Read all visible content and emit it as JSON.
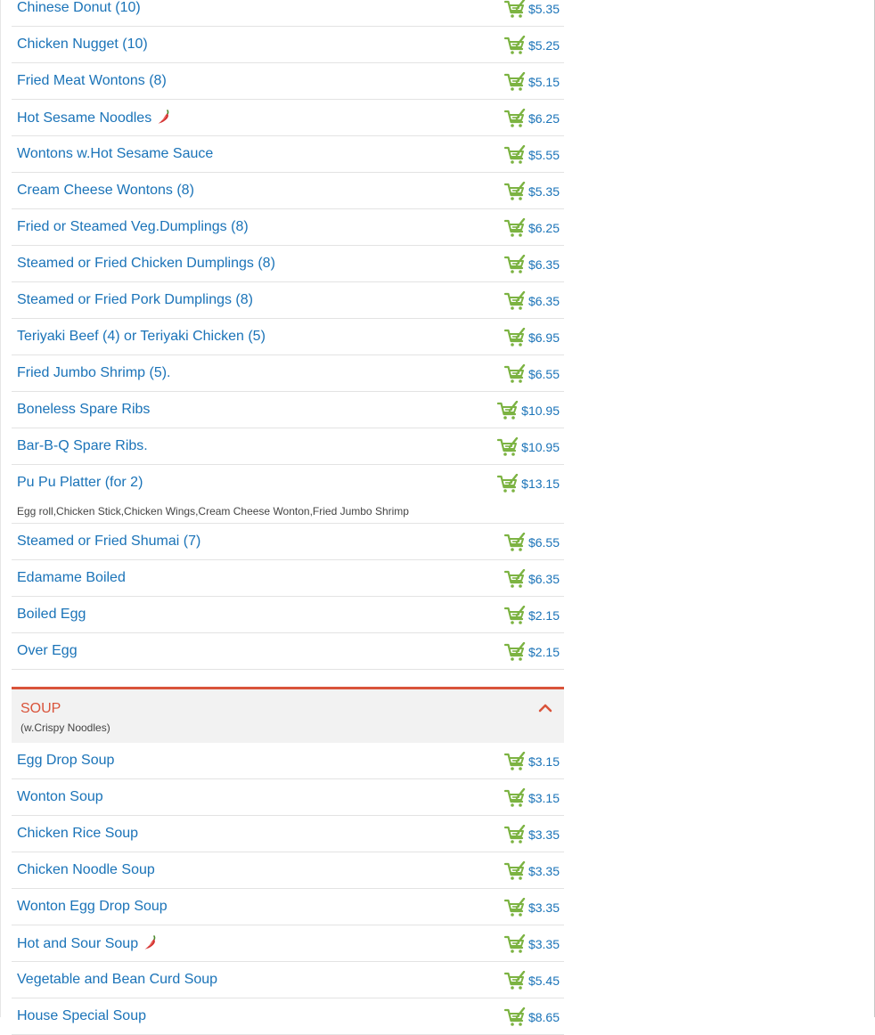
{
  "appetizers": {
    "items": [
      {
        "name": "Chinese Donut (10)",
        "price": "$5.35",
        "spicy": false,
        "desc": ""
      },
      {
        "name": "Chicken Nugget (10)",
        "price": "$5.25",
        "spicy": false,
        "desc": ""
      },
      {
        "name": "Fried Meat Wontons (8)",
        "price": "$5.15",
        "spicy": false,
        "desc": ""
      },
      {
        "name": "Hot Sesame Noodles",
        "price": "$6.25",
        "spicy": true,
        "desc": ""
      },
      {
        "name": "Wontons w.Hot Sesame Sauce",
        "price": "$5.55",
        "spicy": false,
        "desc": ""
      },
      {
        "name": "Cream Cheese Wontons (8)",
        "price": "$5.35",
        "spicy": false,
        "desc": ""
      },
      {
        "name": "Fried or Steamed Veg.Dumplings (8)",
        "price": "$6.25",
        "spicy": false,
        "desc": ""
      },
      {
        "name": "Steamed or Fried Chicken Dumplings (8)",
        "price": "$6.35",
        "spicy": false,
        "desc": ""
      },
      {
        "name": "Steamed or Fried Pork Dumplings (8)",
        "price": "$6.35",
        "spicy": false,
        "desc": ""
      },
      {
        "name": "Teriyaki Beef (4) or Teriyaki Chicken (5)",
        "price": "$6.95",
        "spicy": false,
        "desc": ""
      },
      {
        "name": "Fried Jumbo Shrimp (5).",
        "price": "$6.55",
        "spicy": false,
        "desc": ""
      },
      {
        "name": "Boneless Spare Ribs",
        "price": "$10.95",
        "spicy": false,
        "desc": ""
      },
      {
        "name": "Bar-B-Q Spare Ribs.",
        "price": "$10.95",
        "spicy": false,
        "desc": ""
      },
      {
        "name": "Pu Pu Platter (for 2)",
        "price": "$13.15",
        "spicy": false,
        "desc": "Egg roll,Chicken Stick,Chicken Wings,Cream Cheese Wonton,Fried Jumbo Shrimp"
      },
      {
        "name": "Steamed or Fried Shumai (7)",
        "price": "$6.55",
        "spicy": false,
        "desc": ""
      },
      {
        "name": "Edamame Boiled",
        "price": "$6.35",
        "spicy": false,
        "desc": ""
      },
      {
        "name": "Boiled Egg",
        "price": "$2.15",
        "spicy": false,
        "desc": ""
      },
      {
        "name": "Over Egg",
        "price": "$2.15",
        "spicy": false,
        "desc": ""
      }
    ]
  },
  "soup": {
    "title": "SOUP",
    "subtitle": "(w.Crispy Noodles)",
    "items": [
      {
        "name": "Egg Drop Soup",
        "price": "$3.15",
        "spicy": false,
        "desc": ""
      },
      {
        "name": "Wonton Soup",
        "price": "$3.15",
        "spicy": false,
        "desc": ""
      },
      {
        "name": "Chicken Rice Soup",
        "price": "$3.35",
        "spicy": false,
        "desc": ""
      },
      {
        "name": "Chicken Noodle Soup",
        "price": "$3.35",
        "spicy": false,
        "desc": ""
      },
      {
        "name": "Wonton Egg Drop Soup",
        "price": "$3.35",
        "spicy": false,
        "desc": ""
      },
      {
        "name": "Hot and Sour Soup",
        "price": "$3.35",
        "spicy": true,
        "desc": ""
      },
      {
        "name": "Vegetable and Bean Curd Soup",
        "price": "$5.45",
        "spicy": false,
        "desc": ""
      },
      {
        "name": "House Special Soup",
        "price": "$8.65",
        "spicy": false,
        "desc": ""
      }
    ]
  },
  "colors": {
    "link": "#1a73b8",
    "accent": "#d9533a",
    "cart": "#7cb342",
    "pepper": "#d32f2f"
  },
  "icons": {
    "cart": "shopping-cart-icon",
    "spicy": "chili-pepper-icon",
    "collapse": "chevron-up-icon"
  }
}
